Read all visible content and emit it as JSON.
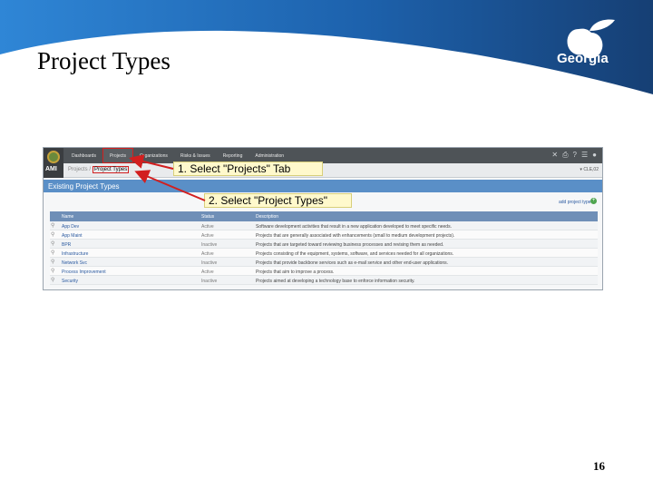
{
  "slide": {
    "title": "Project Types",
    "page_number": "16",
    "logo_text": "Georgia"
  },
  "app": {
    "logo_text": "AMI",
    "nav_tabs": [
      "Dashboards",
      "Projects",
      "Organizations",
      "Risks & Issues",
      "Reporting",
      "Administration"
    ],
    "selected_tab": "Projects",
    "top_icons": [
      "tools-icon",
      "print-icon",
      "help-icon",
      "list-icon",
      "user-icon"
    ],
    "breadcrumb": {
      "parent": "Projects /",
      "current": "Project Types"
    },
    "user_tag": "▾ CLE,02"
  },
  "section": {
    "title": "Existing Project Types",
    "add_link": "add project type"
  },
  "table": {
    "headers": [
      "Name",
      "Status",
      "Description"
    ],
    "rows": [
      {
        "name": "App Dev",
        "status": "Active",
        "description": "Software development activities that result in a new application developed to meet specific needs."
      },
      {
        "name": "App Maint",
        "status": "Active",
        "description": "Projects that are generally associated with enhancements (small to medium development projects)."
      },
      {
        "name": "BPR",
        "status": "Inactive",
        "description": "Projects that are targeted toward reviewing business processes and revising them as needed."
      },
      {
        "name": "Infrastructure",
        "status": "Active",
        "description": "Projects consisting of the equipment, systems, software, and services needed for all organizations."
      },
      {
        "name": "Network Svc",
        "status": "Inactive",
        "description": "Projects that provide backbone services such as e-mail service and other end-user applications."
      },
      {
        "name": "Process Improvement",
        "status": "Active",
        "description": "Projects that aim to improve a process."
      },
      {
        "name": "Security",
        "status": "Inactive",
        "description": "Projects aimed at developing a technology base to enforce information security."
      }
    ]
  },
  "callouts": {
    "step1": "1. Select \"Projects\" Tab",
    "step2": "2. Select \"Project Types\""
  },
  "colors": {
    "banner": "#1a4f8a",
    "section_header": "#5a8fc7",
    "table_header": "#6f8fb7",
    "callout_bg": "#fff9cc",
    "arrow": "#d21f1f"
  }
}
